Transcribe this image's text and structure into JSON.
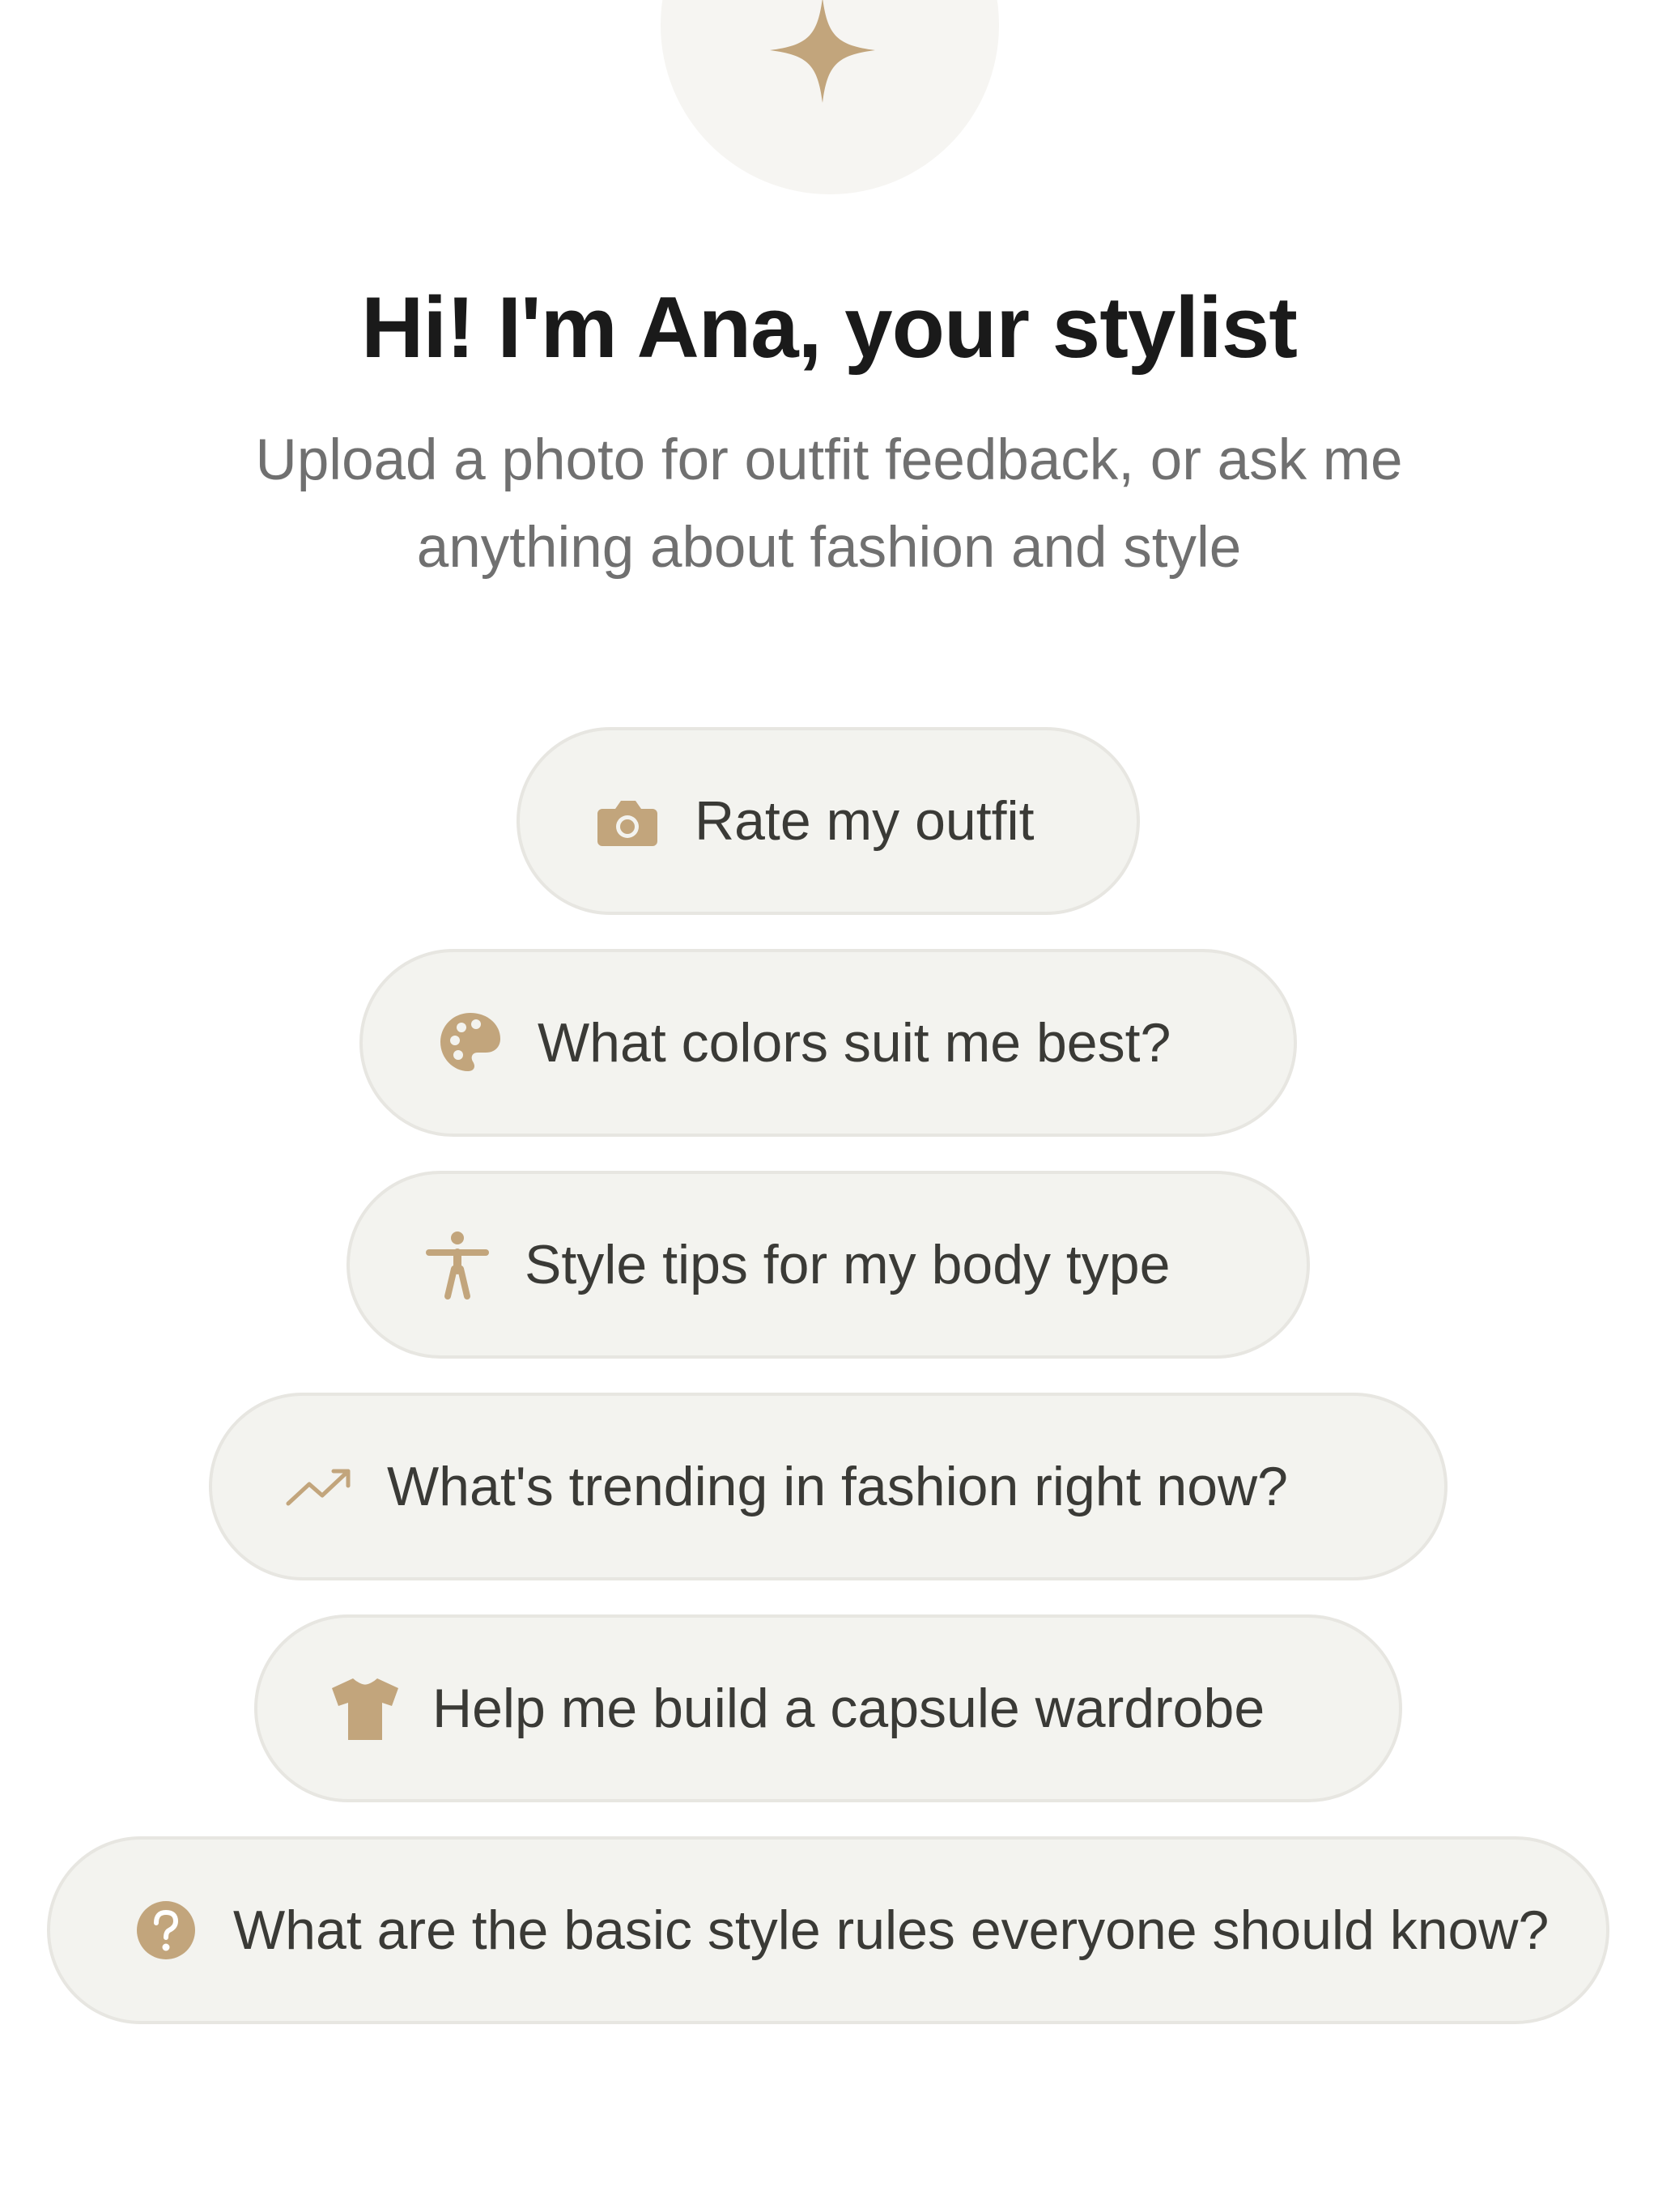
{
  "header": {
    "title": "Hi! I'm Ana, your stylist",
    "subtitle": "Upload a photo for outfit feedback, or ask me anything about fashion and style",
    "avatar_icon": "sparkle-icon"
  },
  "suggestions": [
    {
      "label": "Rate my outfit",
      "icon": "camera-icon"
    },
    {
      "label": "What colors suit me best?",
      "icon": "palette-icon"
    },
    {
      "label": "Style tips for my body type",
      "icon": "person-icon"
    },
    {
      "label": "What's trending in fashion right now?",
      "icon": "trending-up-icon"
    },
    {
      "label": "Help me build a capsule wardrobe",
      "icon": "tshirt-icon"
    },
    {
      "label": "What are the basic style rules everyone should know?",
      "icon": "question-icon"
    }
  ],
  "colors": {
    "accent": "#c2a57c",
    "chip_background": "#f3f3ef",
    "chip_border": "#e7e6e1",
    "title": "#1a1a1a",
    "subtitle": "#707070",
    "chip_text": "#3a3a36",
    "avatar_background": "#f6f5f2"
  }
}
